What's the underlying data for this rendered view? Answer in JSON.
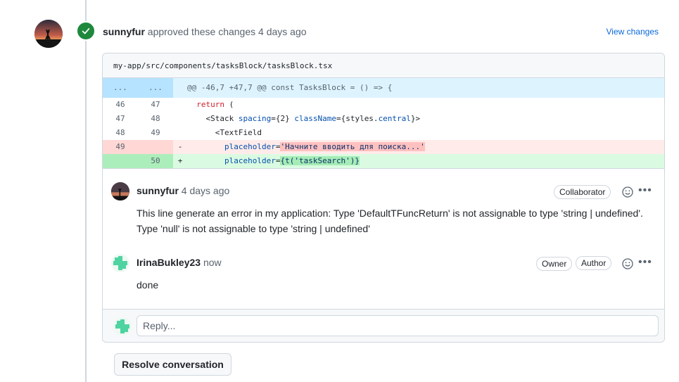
{
  "review": {
    "author": "sunnyfur",
    "action_text": "approved these changes",
    "time": "4 days ago",
    "view_changes": "View changes"
  },
  "file": {
    "path": "my-app/src/components/tasksBlock/tasksBlock.tsx"
  },
  "diff": {
    "hunk": {
      "left": "...",
      "right": "...",
      "text": "@@ -46,7 +47,7 @@ const TasksBlock = () => {"
    },
    "lines": [
      {
        "type": "ctx",
        "left": "46",
        "right": "47",
        "sign": "",
        "indent": "  ",
        "parts": [
          {
            "cls": "kw",
            "text": "return"
          },
          {
            "cls": "tag",
            "text": " ("
          }
        ]
      },
      {
        "type": "ctx",
        "left": "47",
        "right": "48",
        "sign": "",
        "indent": "    ",
        "parts": [
          {
            "cls": "tag",
            "text": "<Stack "
          },
          {
            "cls": "attr",
            "text": "spacing"
          },
          {
            "cls": "tag",
            "text": "={2} "
          },
          {
            "cls": "attr",
            "text": "className"
          },
          {
            "cls": "tag",
            "text": "={styles."
          },
          {
            "cls": "attr",
            "text": "central"
          },
          {
            "cls": "tag",
            "text": "}>"
          }
        ]
      },
      {
        "type": "ctx",
        "left": "48",
        "right": "49",
        "sign": "",
        "indent": "      ",
        "parts": [
          {
            "cls": "tag",
            "text": "<TextField"
          }
        ]
      },
      {
        "type": "del",
        "left": "49",
        "right": "",
        "sign": "-",
        "indent": "        ",
        "parts": [
          {
            "cls": "attr",
            "text": "placeholder"
          },
          {
            "cls": "tag",
            "text": "="
          },
          {
            "cls": "str-del",
            "text": "'Начните вводить для поиска...'"
          }
        ]
      },
      {
        "type": "add",
        "left": "",
        "right": "50",
        "sign": "+",
        "indent": "        ",
        "parts": [
          {
            "cls": "attr",
            "text": "placeholder"
          },
          {
            "cls": "tag",
            "text": "="
          },
          {
            "cls": "str-add",
            "text": "{t('taskSearch')}"
          }
        ]
      }
    ]
  },
  "comments": [
    {
      "author": "sunnyfur",
      "time": "4 days ago",
      "labels": [
        "Collaborator"
      ],
      "body_line1": "This line generate an error in my application: Type 'DefaultTFuncReturn' is not assignable to type 'string | undefined'.",
      "body_line2": "Type 'null' is not assignable to type 'string | undefined'"
    },
    {
      "author": "IrinaBukley23",
      "time": "now",
      "labels": [
        "Owner",
        "Author"
      ],
      "body_line1": "done"
    }
  ],
  "reply": {
    "placeholder": "Reply..."
  },
  "resolve": {
    "label": "Resolve conversation"
  },
  "icons": {
    "approved": "check-circle-icon",
    "emoji": "smiley-icon",
    "more": "kebab-horizontal-icon"
  },
  "colors": {
    "approved_green": "#1f883d",
    "link_blue": "#0969da",
    "hunk_bg": "#ddf4ff",
    "deleted_bg": "#ffebe9",
    "added_bg": "#dafbe1"
  }
}
